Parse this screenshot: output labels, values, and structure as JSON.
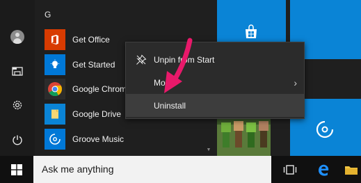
{
  "app_list": {
    "group_letter": "G",
    "items": [
      {
        "label": "Get Office",
        "icon": "office-icon",
        "tile_color": "#d83b01"
      },
      {
        "label": "Get Started",
        "icon": "lightbulb-icon",
        "tile_color": "#0078d7"
      },
      {
        "label": "Google Chrome",
        "icon": "chrome-icon",
        "tile_color": "#2b2b2b"
      },
      {
        "label": "Google Drive",
        "icon": "drive-icon",
        "tile_color": "#0a84d6"
      },
      {
        "label": "Groove Music",
        "icon": "groove-icon",
        "tile_color": "#0078d7"
      }
    ]
  },
  "context_menu": {
    "items": [
      {
        "label": "Unpin from Start",
        "icon": "unpin-icon"
      },
      {
        "label": "More",
        "icon": "",
        "has_submenu": true
      },
      {
        "label": "Uninstall",
        "icon": "",
        "highlighted": true
      }
    ]
  },
  "taskbar": {
    "search_placeholder": "Ask me anything"
  },
  "colors": {
    "tile_blue": "#0a84d6",
    "annotation_arrow": "#e8196a"
  }
}
